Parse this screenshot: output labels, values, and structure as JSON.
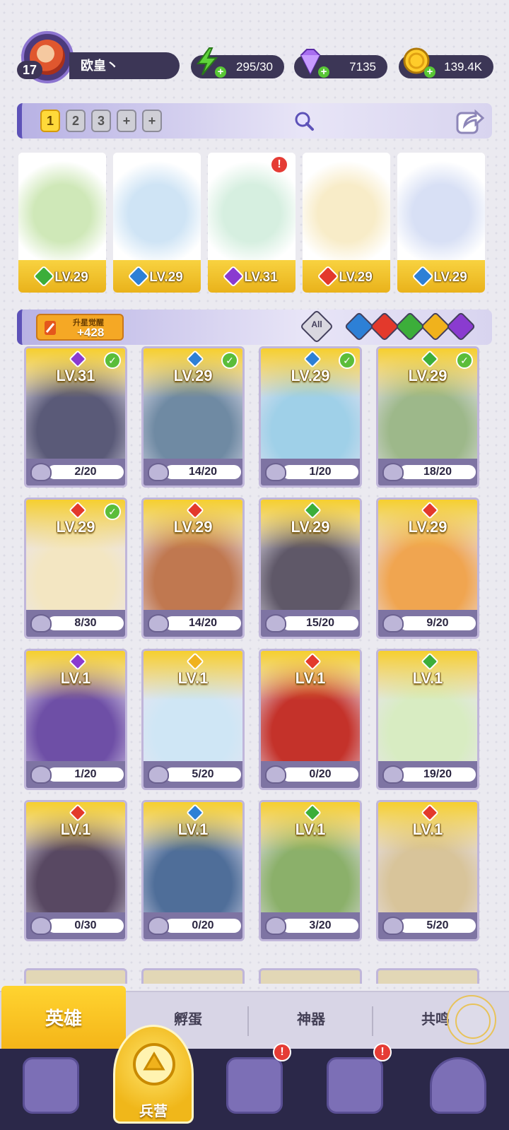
{
  "player": {
    "level": "17",
    "name": "欧皇丶"
  },
  "resources": [
    {
      "icon": "energy-bolt-icon",
      "value": "295/30"
    },
    {
      "icon": "diamond-gem-icon",
      "value": "7135"
    },
    {
      "icon": "gold-coin-icon",
      "value": "139.4K"
    }
  ],
  "team_slots": [
    "1",
    "2",
    "3",
    "+",
    "+"
  ],
  "lineup": [
    {
      "level": "LV.29",
      "element": "wind",
      "color": "#3cae3a"
    },
    {
      "level": "LV.29",
      "element": "water",
      "color": "#2d80d6"
    },
    {
      "level": "LV.31",
      "element": "dark",
      "color": "#8a3bd0",
      "alert": "!"
    },
    {
      "level": "LV.29",
      "element": "fire",
      "color": "#e3392c"
    },
    {
      "level": "LV.29",
      "element": "water",
      "color": "#2d80d6"
    }
  ],
  "star_awaken": {
    "label": "升星觉醒",
    "count": "+428"
  },
  "filter_all": "All",
  "filters": [
    {
      "element": "water",
      "color": "#2d80d6"
    },
    {
      "element": "fire",
      "color": "#e3392c"
    },
    {
      "element": "wind",
      "color": "#3cae3a"
    },
    {
      "element": "light",
      "color": "#f0b21c"
    },
    {
      "element": "dark",
      "color": "#8a3bd0"
    }
  ],
  "heroes": [
    {
      "level": "LV.31",
      "progress": "2/20",
      "color": "#8a3bd0",
      "checked": true
    },
    {
      "level": "LV.29",
      "progress": "14/20",
      "color": "#2d80d6",
      "checked": true
    },
    {
      "level": "LV.29",
      "progress": "1/20",
      "color": "#2d80d6",
      "checked": true
    },
    {
      "level": "LV.29",
      "progress": "18/20",
      "color": "#3cae3a",
      "checked": true
    },
    {
      "level": "LV.29",
      "progress": "8/30",
      "color": "#e3392c",
      "checked": true
    },
    {
      "level": "LV.29",
      "progress": "14/20",
      "color": "#e3392c",
      "checked": false
    },
    {
      "level": "LV.29",
      "progress": "15/20",
      "color": "#3cae3a",
      "checked": false
    },
    {
      "level": "LV.29",
      "progress": "9/20",
      "color": "#e3392c",
      "checked": false
    },
    {
      "level": "LV.1",
      "progress": "1/20",
      "color": "#8a3bd0",
      "checked": false
    },
    {
      "level": "LV.1",
      "progress": "5/20",
      "color": "#f0b21c",
      "checked": false
    },
    {
      "level": "LV.1",
      "progress": "0/20",
      "color": "#e3392c",
      "checked": false
    },
    {
      "level": "LV.1",
      "progress": "19/20",
      "color": "#3cae3a",
      "checked": false
    },
    {
      "level": "LV.1",
      "progress": "0/30",
      "color": "#e3392c",
      "checked": false
    },
    {
      "level": "LV.1",
      "progress": "0/20",
      "color": "#2d80d6",
      "checked": false
    },
    {
      "level": "LV.1",
      "progress": "3/20",
      "color": "#3cae3a",
      "checked": false
    },
    {
      "level": "LV.1",
      "progress": "5/20",
      "color": "#e3392c",
      "checked": false
    }
  ],
  "tabs": [
    {
      "label": "英雄",
      "active": true
    },
    {
      "label": "孵蛋"
    },
    {
      "label": "神器"
    },
    {
      "label": "共鸣"
    }
  ],
  "nav": [
    {
      "icon": "cards-icon"
    },
    {
      "icon": "barracks-icon",
      "label": "兵营",
      "active": true
    },
    {
      "icon": "map-book-icon",
      "alert": "!"
    },
    {
      "icon": "temple-icon",
      "alert": "!"
    },
    {
      "icon": "shop-icon"
    }
  ]
}
